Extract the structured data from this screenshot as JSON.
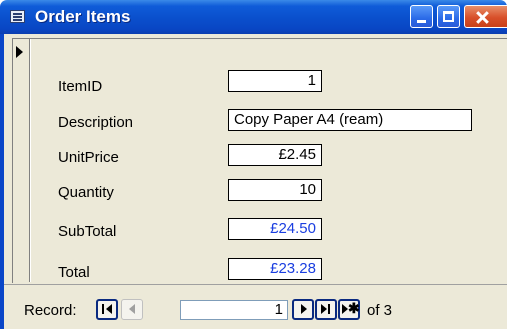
{
  "window": {
    "title": "Order Items",
    "buttons": {
      "minimize": "minimize",
      "maximize": "maximize",
      "close": "close"
    }
  },
  "form": {
    "fields": [
      {
        "label": "ItemID",
        "value": "1"
      },
      {
        "label": "Description",
        "value": "Copy Paper A4 (ream)"
      },
      {
        "label": "UnitPrice",
        "value": "£2.45"
      },
      {
        "label": "Quantity",
        "value": "10"
      },
      {
        "label": "SubTotal",
        "value": "£24.50"
      },
      {
        "label": "Total",
        "value": "£23.28"
      }
    ]
  },
  "navigation": {
    "record_label": "Record:",
    "current_record": "1",
    "of_text": "of 3"
  },
  "colors": {
    "titlebar": "#0a4fcc",
    "calculated_text": "#1a3ee0",
    "form_background": "#ece9d8"
  }
}
